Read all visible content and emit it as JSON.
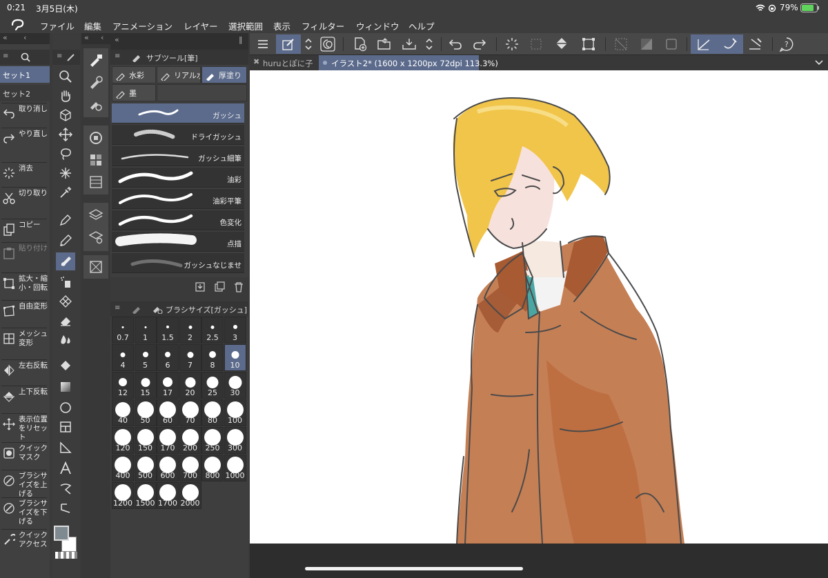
{
  "status": {
    "time": "0:21",
    "date": "3月5日(木)",
    "battery": "79%"
  },
  "menu": [
    "ファイル",
    "編集",
    "アニメーション",
    "レイヤー",
    "選択範囲",
    "表示",
    "フィルター",
    "ウィンドウ",
    "ヘルプ"
  ],
  "tabs": [
    {
      "label": "huruとぽに子",
      "active": false
    },
    {
      "label": "イラスト2* (1600 x 1200px 72dpi 113.3%)",
      "active": true
    }
  ],
  "commands": [
    {
      "label": "取り消し",
      "icon": "undo-icon"
    },
    {
      "label": "やり直し",
      "icon": "redo-icon"
    },
    {
      "label": "消去",
      "icon": "clear-icon"
    },
    {
      "label": "切り取り",
      "icon": "scissors-icon"
    },
    {
      "label": "コピー",
      "icon": "copy-icon"
    },
    {
      "label": "貼り付け",
      "icon": "paste-icon"
    },
    {
      "label": "拡大・縮小・回転",
      "icon": "scale-rotate-icon"
    },
    {
      "label": "自由変形",
      "icon": "free-transform-icon"
    },
    {
      "label": "メッシュ変形",
      "icon": "mesh-transform-icon"
    },
    {
      "label": "左右反転",
      "icon": "flip-horizontal-icon"
    },
    {
      "label": "上下反転",
      "icon": "flip-vertical-icon"
    },
    {
      "label": "表示位置をリセット",
      "icon": "reset-view-icon"
    },
    {
      "label": "クイックマスク",
      "icon": "quick-mask-icon"
    },
    {
      "label": "ブラシサイズを上げる",
      "icon": "brush-size-up-icon"
    },
    {
      "label": "ブラシサイズを下げる",
      "icon": "brush-size-down-icon"
    },
    {
      "label": "クイックアクセス",
      "icon": "quick-access-icon"
    }
  ],
  "sets": {
    "tab1": "セット1",
    "tab2": "セット2"
  },
  "subtool": {
    "title": "サブツール[筆]",
    "categories": [
      {
        "label": "水彩",
        "active": false
      },
      {
        "label": "リアル水彩",
        "active": false
      },
      {
        "label": "厚塗り",
        "active": true
      },
      {
        "label": "墨",
        "active": false
      }
    ],
    "brushes": [
      {
        "name": "ガッシュ",
        "active": true
      },
      {
        "name": "ドライガッシュ",
        "active": false
      },
      {
        "name": "ガッシュ細筆",
        "active": false
      },
      {
        "name": "油彩",
        "active": false
      },
      {
        "name": "油彩平筆",
        "active": false
      },
      {
        "name": "色変化",
        "active": false
      },
      {
        "name": "点描",
        "active": false
      },
      {
        "name": "ガッシュなじませ",
        "active": false
      }
    ]
  },
  "brushsize": {
    "title": "ブラシサイズ[ガッシュ]",
    "sizes": [
      "0.7",
      "1",
      "1.5",
      "2",
      "2.5",
      "3",
      "4",
      "5",
      "6",
      "7",
      "8",
      "10",
      "12",
      "15",
      "17",
      "20",
      "25",
      "30",
      "40",
      "50",
      "60",
      "70",
      "80",
      "100",
      "120",
      "150",
      "170",
      "200",
      "250",
      "300",
      "400",
      "500",
      "600",
      "700",
      "800",
      "1000",
      "1200",
      "1500",
      "1700",
      "2000"
    ],
    "selected": "10"
  },
  "colors": {
    "accent": "#5c6b8c",
    "main_color": "#7f8a90",
    "sub_color": "#ffffff",
    "jacket": "#b8693f",
    "hair": "#f0c64a",
    "tie": "#4aa6a3"
  }
}
